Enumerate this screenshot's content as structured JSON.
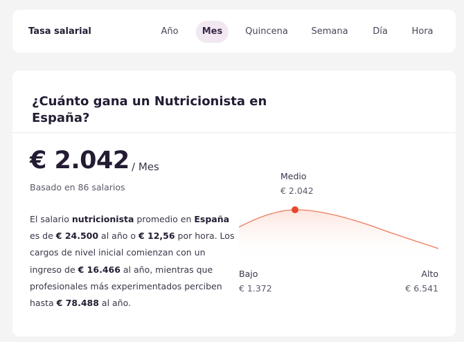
{
  "rate_bar": {
    "label": "Tasa salarial",
    "tabs": [
      {
        "label": "Año",
        "active": false
      },
      {
        "label": "Mes",
        "active": true
      },
      {
        "label": "Quincena",
        "active": false
      },
      {
        "label": "Semana",
        "active": false
      },
      {
        "label": "Día",
        "active": false
      },
      {
        "label": "Hora",
        "active": false
      }
    ]
  },
  "salary": {
    "title": "¿Cuánto gana un Nutricionista en España?",
    "amount": "€ 2.042",
    "period": "/ Mes",
    "based_on": "Basado en 86 salarios",
    "description": {
      "p1": "El salario ",
      "job": "nutricionista",
      "p2": " promedio en ",
      "country": "España",
      "p3": " es de ",
      "year_amount": "€ 24.500",
      "p4": " al año o ",
      "hour_amount": "€ 12,56",
      "p5": " por hora. Los cargos de nivel inicial comienzan con un ingreso de ",
      "entry_amount": "€ 16.466",
      "p6": " al año, mientras que profesionales más experimentados perciben hasta ",
      "top_amount": "€ 78.488",
      "p7": " al año."
    }
  },
  "chart": {
    "medio_label": "Medio",
    "medio_value": "€ 2.042",
    "bajo_label": "Bajo",
    "bajo_value": "€ 1.372",
    "alto_label": "Alto",
    "alto_value": "€ 6.541",
    "colors": {
      "curve": "#ec7a5c",
      "marker": "#e8472b",
      "fill": "#fde3dc"
    }
  }
}
